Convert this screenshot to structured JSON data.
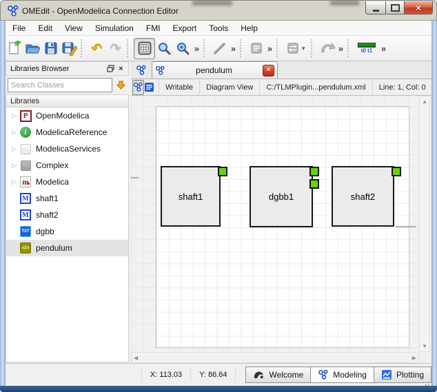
{
  "window": {
    "title": "OMEdit - OpenModelica Connection Editor"
  },
  "menubar": [
    "File",
    "Edit",
    "View",
    "Simulation",
    "FMI",
    "Export",
    "Tools",
    "Help"
  ],
  "toolbar": {
    "sim_time_label": "t0 t1"
  },
  "icons": {
    "overflow": "»",
    "dropdown": "▾",
    "window_close": "×",
    "tab_close": "×",
    "dock_close": "×",
    "tree_expand": "▷",
    "scroll_up": "▲",
    "scroll_down": "▼",
    "scroll_left": "◀",
    "scroll_right": "▶",
    "openmodelica_letter": "P",
    "info_letter": "i",
    "modelica_letter": "m",
    "model_letter": "M",
    "txt_label": "TXT",
    "code_label": "</>"
  },
  "libraries_browser": {
    "title": "Libraries Browser",
    "search_placeholder": "Search Classes",
    "section_header": "Libraries",
    "items": [
      {
        "label": "OpenModelica"
      },
      {
        "label": "ModelicaReference"
      },
      {
        "label": "ModelicaServices"
      },
      {
        "label": "Complex"
      },
      {
        "label": "Modelica"
      },
      {
        "label": "shaft1"
      },
      {
        "label": "shaft2"
      },
      {
        "label": "dgbb"
      },
      {
        "label": "pendulum"
      }
    ]
  },
  "editor": {
    "tab_label": "pendulum",
    "writable_label": "Writable",
    "view_label": "Diagram View",
    "file_path": "C:/TLMPlugin...pendulum.xml",
    "cursor_position": "Line: 1, Col: 0"
  },
  "canvas": {
    "components": [
      {
        "name": "shaft1",
        "ports": 1
      },
      {
        "name": "dgbb1",
        "ports": 2
      },
      {
        "name": "shaft2",
        "ports": 1
      }
    ]
  },
  "statusbar": {
    "x_coordinate": "X: 113.03",
    "y_coordinate": "Y: 86.64",
    "perspectives": [
      {
        "label": "Welcome"
      },
      {
        "label": "Modeling"
      },
      {
        "label": "Plotting"
      }
    ]
  },
  "colors": {
    "port_green": "#69d303",
    "accent_blue": "#2459c4",
    "close_red": "#c23b2a",
    "undo_yellow": "#e9b41f",
    "search_arrow_yellow": "#f2a71d",
    "selection_gray": "#e4e4e4"
  }
}
